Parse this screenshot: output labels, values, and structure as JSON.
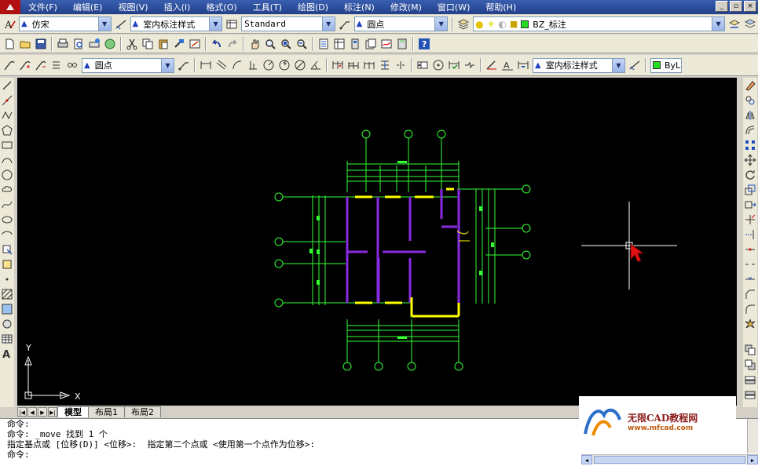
{
  "menu": {
    "items": [
      "文件(F)",
      "编辑(E)",
      "视图(V)",
      "插入(I)",
      "格式(O)",
      "工具(T)",
      "绘图(D)",
      "标注(N)",
      "修改(M)",
      "窗口(W)",
      "帮助(H)"
    ]
  },
  "toolbar1": {
    "text_style": "仿宋",
    "dim_style": "室内标注样式",
    "table_style": "Standard",
    "multileader_style": "圆点",
    "layer": "BZ_标注"
  },
  "toolbar3": {
    "multileader_style": "圆点",
    "dim_style": "室内标注样式",
    "color": "ByLa"
  },
  "canvas": {
    "ucs_x": "X",
    "ucs_y": "Y",
    "background_color": "#000000",
    "line_color": "#33ff33",
    "wall_color": "#8a2be2",
    "window_color": "#ffff00"
  },
  "tabs": {
    "items": [
      "模型",
      "布局1",
      "布局2"
    ],
    "active": "模型"
  },
  "command": {
    "lines": [
      "命令:",
      "命令: _move 找到 1 个",
      "指定基点或 [位移(D)] <位移>:  指定第二个点或 <使用第一个点作为位移>:",
      "命令:"
    ]
  },
  "watermark": {
    "brand": "无限CAD教程网",
    "url": "www.mfcad.com"
  }
}
